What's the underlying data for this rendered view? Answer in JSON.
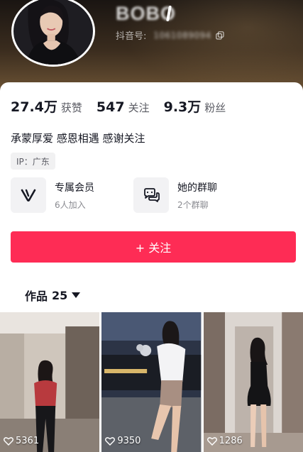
{
  "header": {
    "nickname": "BOBO",
    "douyin_label": "抖音号:",
    "douyin_id": "1061089094"
  },
  "stats": [
    {
      "value": "27.4万",
      "label": "获赞"
    },
    {
      "value": "547",
      "label": "关注"
    },
    {
      "value": "9.3万",
      "label": "粉丝"
    }
  ],
  "bio": "承蒙厚爱 感恩相遇 感谢关注",
  "ip_tag": "IP：广东",
  "features": [
    {
      "title": "专属会员",
      "subtitle": "6人加入",
      "icon": "vip-v-icon"
    },
    {
      "title": "她的群聊",
      "subtitle": "2个群聊",
      "icon": "chat-bubbles-icon"
    }
  ],
  "follow_button": "+ 关注",
  "works": {
    "label": "作品",
    "count": "25"
  },
  "videos": [
    {
      "likes": "5361"
    },
    {
      "likes": "9350"
    },
    {
      "likes": "1286"
    }
  ],
  "colors": {
    "accent": "#fe2c55",
    "text_primary": "#161823",
    "text_secondary": "#8a8b91"
  }
}
